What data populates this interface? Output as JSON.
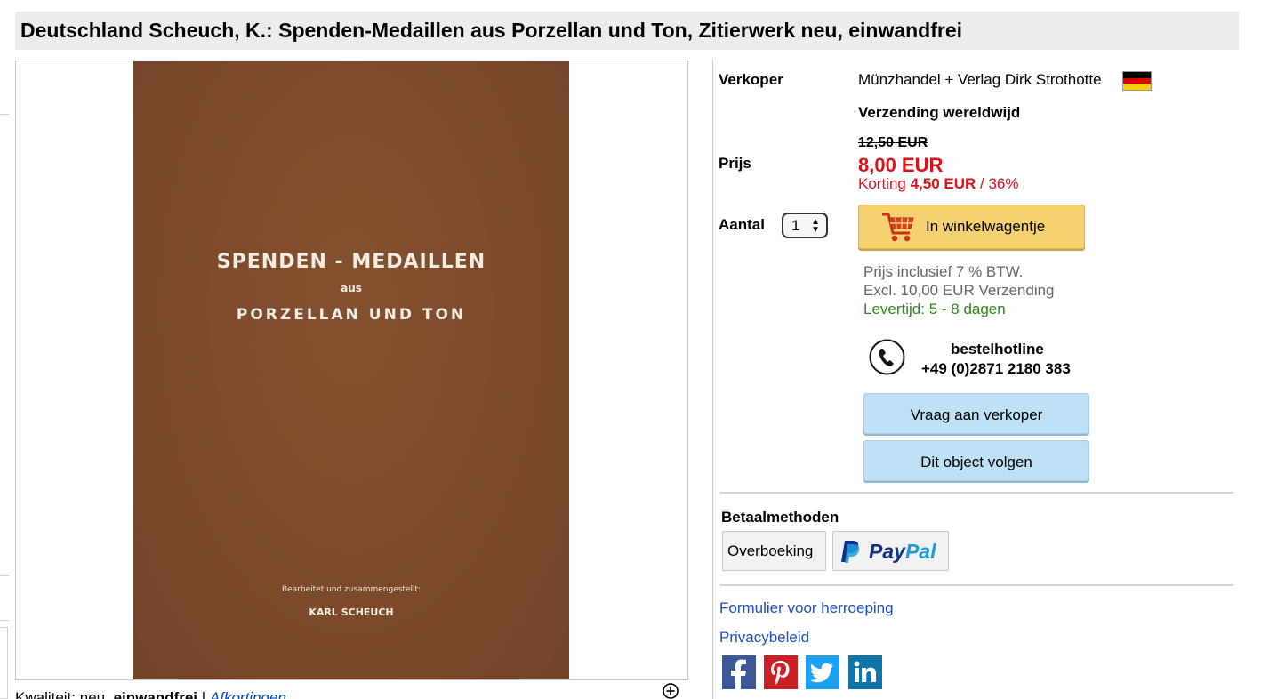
{
  "title": "Deutschland Scheuch, K.: Spenden-Medaillen aus Porzellan und Ton, Zitierwerk neu, einwandfrei",
  "cover": {
    "line1": "SPENDEN - MEDAILLEN",
    "line2": "aus",
    "line3": "PORZELLAN UND TON",
    "line4": "Bearbeitet und zusammengestellt:",
    "line5": "KARL SCHEUCH"
  },
  "caption": {
    "quality_label": "Kwaliteit: neu, ",
    "quality_value": "einwandfrei",
    "separator": " | ",
    "abbreviations_link": "Afkortingen"
  },
  "seller": {
    "label": "Verkoper",
    "name": "Münzhandel + Verlag Dirk Strothotte",
    "flag_colors": [
      "#000000",
      "#dd0000",
      "#ffce00"
    ]
  },
  "shipping": "Verzending wereldwijd",
  "price": {
    "label": "Prijs",
    "old": "12,50 EUR",
    "new": "8,00 EUR",
    "discount_label": "Korting ",
    "discount_amount": "4,50 EUR",
    "discount_percent": " / 36%"
  },
  "quantity": {
    "label": "Aantal",
    "value": "1"
  },
  "cart_button": "In winkelwagentje",
  "tax": {
    "line1": "Prijs inclusief 7 % BTW.",
    "line2": "Excl. 10,00 EUR Verzending",
    "delivery": "Levertijd: 5 - 8 dagen"
  },
  "hotline": {
    "title": "bestelhotline",
    "number": "+49 (0)2871 2180 383"
  },
  "buttons": {
    "ask_seller": "Vraag aan verkoper",
    "follow": "Dit object volgen"
  },
  "payment": {
    "title": "Betaalmethoden",
    "bank": "Overboeking",
    "paypal_part1": "Pay",
    "paypal_part2": "Pal"
  },
  "links": {
    "withdrawal": "Formulier voor herroeping",
    "privacy": "Privacybeleid"
  },
  "social": [
    "facebook-icon",
    "pinterest-icon",
    "twitter-icon",
    "linkedin-icon"
  ],
  "colors": {
    "price_red": "#e0101a",
    "cart_yellow": "#f6d16f",
    "button_blue": "#bfe1f6",
    "link_blue": "#1b4fc5",
    "delivery_green": "#2b8a18"
  }
}
